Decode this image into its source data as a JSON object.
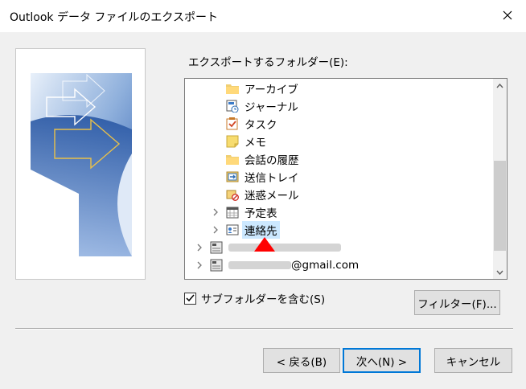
{
  "window": {
    "title": "Outlook データ ファイルのエクスポート"
  },
  "folder_label": "エクスポートするフォルダー(E):",
  "tree": {
    "items": [
      {
        "label": "アーカイブ",
        "icon": "folder-icon",
        "expandable": false
      },
      {
        "label": "ジャーナル",
        "icon": "journal-icon",
        "expandable": false
      },
      {
        "label": "タスク",
        "icon": "task-icon",
        "expandable": false
      },
      {
        "label": "メモ",
        "icon": "note-icon",
        "expandable": false
      },
      {
        "label": "会話の履歴",
        "icon": "folder-icon",
        "expandable": false
      },
      {
        "label": "送信トレイ",
        "icon": "outbox-icon",
        "expandable": false
      },
      {
        "label": "迷惑メール",
        "icon": "junk-mail-icon",
        "expandable": false
      },
      {
        "label": "予定表",
        "icon": "calendar-icon",
        "expandable": true
      },
      {
        "label": "連絡先",
        "icon": "contacts-icon",
        "expandable": true,
        "selected": true
      },
      {
        "label": "",
        "icon": "data-file-icon",
        "expandable": true
      },
      {
        "label": "@gmail.com",
        "icon": "data-file-icon",
        "expandable": true
      }
    ]
  },
  "include_subfolders": {
    "label": "サブフォルダーを含む(S)",
    "checked": true
  },
  "buttons": {
    "filter": "フィルター(F)...",
    "back": "< 戻る(B)",
    "next": "次へ(N) >",
    "cancel": "キャンセル"
  },
  "colors": {
    "selection": "#cce8ff",
    "default_button_border": "#0078d7",
    "annotation_arrow": "#ff0000"
  }
}
